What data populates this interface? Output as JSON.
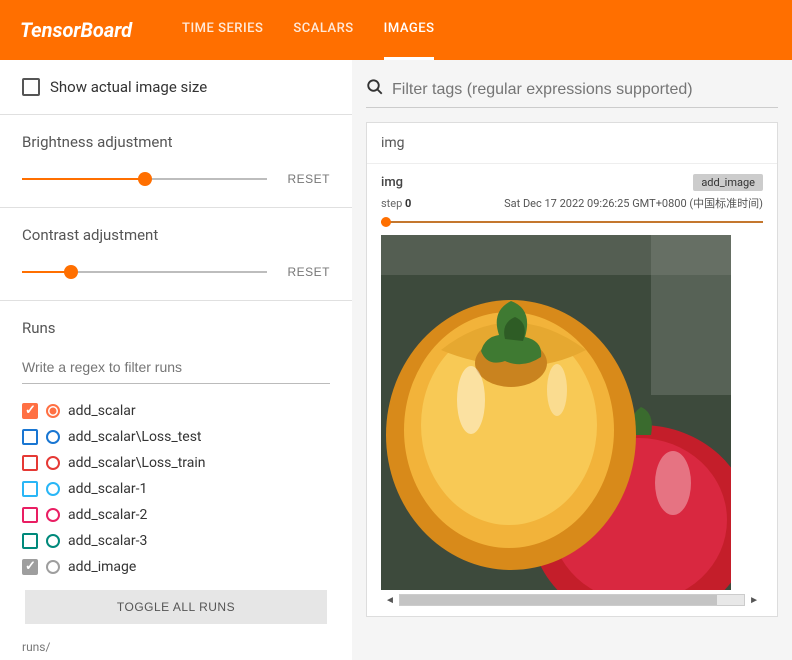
{
  "header": {
    "logo": "TensorBoard",
    "tabs": [
      {
        "label": "TIME SERIES",
        "active": false
      },
      {
        "label": "SCALARS",
        "active": false
      },
      {
        "label": "IMAGES",
        "active": true
      }
    ]
  },
  "sidebar": {
    "show_actual_size": {
      "label": "Show actual image size",
      "checked": false
    },
    "brightness": {
      "label": "Brightness adjustment",
      "reset": "RESET",
      "value": 0.5
    },
    "contrast": {
      "label": "Contrast adjustment",
      "reset": "RESET",
      "value": 0.2
    },
    "runs": {
      "header": "Runs",
      "filter_placeholder": "Write a regex to filter runs",
      "items": [
        {
          "label": "add_scalar",
          "color": "#ff7043",
          "checked": true,
          "radio_filled": true
        },
        {
          "label": "add_scalar\\Loss_test",
          "color": "#1976d2",
          "checked": false,
          "radio_filled": false
        },
        {
          "label": "add_scalar\\Loss_train",
          "color": "#e53935",
          "checked": false,
          "radio_filled": false
        },
        {
          "label": "add_scalar-1",
          "color": "#29b6f6",
          "checked": false,
          "radio_filled": false
        },
        {
          "label": "add_scalar-2",
          "color": "#e91e63",
          "checked": false,
          "radio_filled": false
        },
        {
          "label": "add_scalar-3",
          "color": "#00897b",
          "checked": false,
          "radio_filled": false
        },
        {
          "label": "add_image",
          "color": "#9e9e9e",
          "checked": true,
          "radio_filled": false
        }
      ],
      "toggle_all": "TOGGLE ALL RUNS",
      "footer": "runs/"
    }
  },
  "main": {
    "search_placeholder": "Filter tags (regular expressions supported)",
    "card": {
      "header": "img",
      "image_title": "img",
      "tag": "add_image",
      "step_label": "step",
      "step_value": "0",
      "timestamp": "Sat Dec 17 2022 09:26:25 GMT+0800 (中国标准时间)"
    }
  }
}
